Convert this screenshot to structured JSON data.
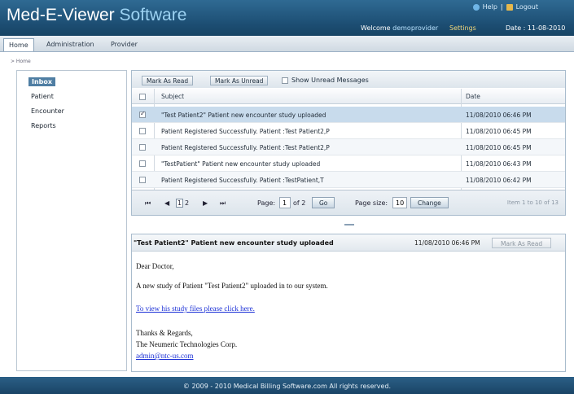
{
  "header": {
    "title_main": "Med-E-Viewer ",
    "title_soft": "Software",
    "help_label": "Help",
    "separator": "|",
    "logout_label": "Logout",
    "welcome_prefix": "Welcome ",
    "user": "demoprovider",
    "settings_label": "Settings",
    "date_text": "Date : 11-08-2010"
  },
  "nav": {
    "tabs": [
      {
        "label": "Home"
      },
      {
        "label": "Administration"
      },
      {
        "label": "Provider"
      }
    ]
  },
  "breadcrumb": "> Home",
  "sidebar": {
    "items": [
      {
        "label": "Inbox"
      },
      {
        "label": "Patient"
      },
      {
        "label": "Encounter"
      },
      {
        "label": "Reports"
      }
    ]
  },
  "inbox": {
    "toolbar": {
      "mark_read": "Mark As Read",
      "mark_unread": "Mark As Unread",
      "show_unread": "Show Unread Messages"
    },
    "columns": {
      "subject": "Subject",
      "date": "Date"
    },
    "rows": [
      {
        "subject": "\"Test Patient2\" Patient new encounter study uploaded",
        "date": "11/08/2010 06:46 PM",
        "checked": true
      },
      {
        "subject": "Patient Registered Successfully. Patient :Test Patient2,P",
        "date": "11/08/2010 06:45 PM",
        "checked": false
      },
      {
        "subject": "Patient Registered Successfully. Patient :Test Patient2,P",
        "date": "11/08/2010 06:45 PM",
        "checked": false
      },
      {
        "subject": "\"TestPatient\" Patient new encounter study uploaded",
        "date": "11/08/2010 06:43 PM",
        "checked": false
      },
      {
        "subject": "Patient Registered Successfully. Patient :TestPatient,T",
        "date": "11/08/2010 06:42 PM",
        "checked": false
      }
    ],
    "pager": {
      "first": "⏮",
      "prev": "◀",
      "page1": "1",
      "page2": "2",
      "next": "▶",
      "last": "⏭",
      "page_label": "Page:",
      "page_value": "1",
      "of_label": "of 2",
      "go": "Go",
      "size_label": "Page size:",
      "size_value": "10",
      "change": "Change",
      "info": "Item 1 to 10 of 13"
    }
  },
  "detail": {
    "subject": "\"Test Patient2\" Patient new encounter study uploaded",
    "date": "11/08/2010 06:46 PM",
    "mark_read": "Mark As Read",
    "lines": {
      "greeting": "Dear Doctor,",
      "body": "A new study of Patient \"Test Patient2\" uploaded in to our system.",
      "link": "To view his study files please click here.",
      "thanks": "Thanks & Regards,",
      "company": "The Neumeric Technologies Corp.",
      "email": "admin@ntc-us.com"
    }
  },
  "footer": {
    "copyright": "© 2009 - 2010 Medical Billing Software.com All rights reserved."
  }
}
